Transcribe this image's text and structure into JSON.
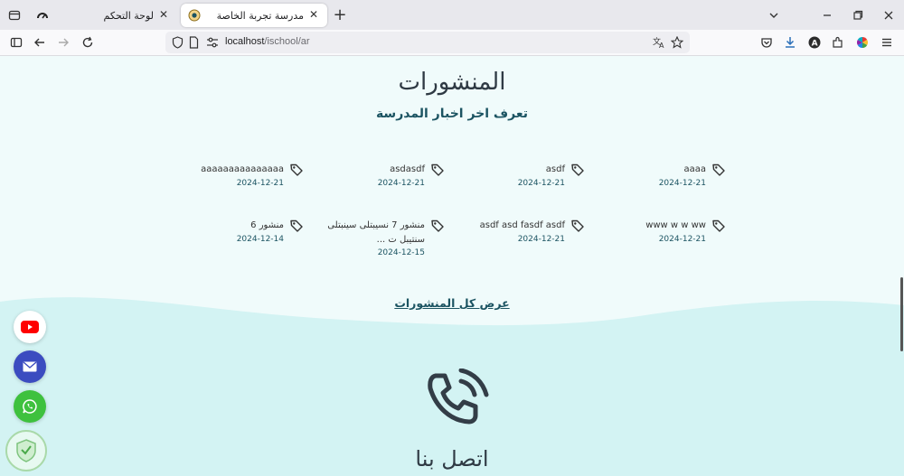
{
  "browser": {
    "tabs": [
      {
        "title": "لوحة التحكم",
        "active": false,
        "icon": "dashboard-gauge-icon"
      },
      {
        "title": "مدرسة تجربة الخاصة",
        "active": true,
        "icon": "school-logo-icon"
      }
    ],
    "url": {
      "host": "localhost",
      "path": "/ischool/ar"
    }
  },
  "page": {
    "heading": "المنشورات",
    "subheading": "تعرف اخر اخبار المدرسة",
    "posts": [
      {
        "title": "aaaa",
        "date": "2024-12-21"
      },
      {
        "title": "asdf",
        "date": "2024-12-21"
      },
      {
        "title": "asdasdf",
        "date": "2024-12-21"
      },
      {
        "title": "aaaaaaaaaaaaaaa",
        "date": "2024-12-21"
      },
      {
        "title": "www w w ww",
        "date": "2024-12-21"
      },
      {
        "title": "asdf asd fasdf asdf",
        "date": "2024-12-21"
      },
      {
        "title": "منشور 7 نسيبتلى سينبتلى سنتيبل ت ...",
        "date": "2024-12-15"
      },
      {
        "title": "منشور 6",
        "date": "2024-12-14"
      }
    ],
    "all_posts_link": "عرض كل المنشورات",
    "contact_title": "اتصل بنا"
  },
  "colors": {
    "accent": "#1c5462",
    "page_bg": "#f0fbfb",
    "wave": "#d3f3f3",
    "youtube": "#ff0000",
    "email": "#3b4cc0",
    "whatsapp": "#3ec13e"
  }
}
